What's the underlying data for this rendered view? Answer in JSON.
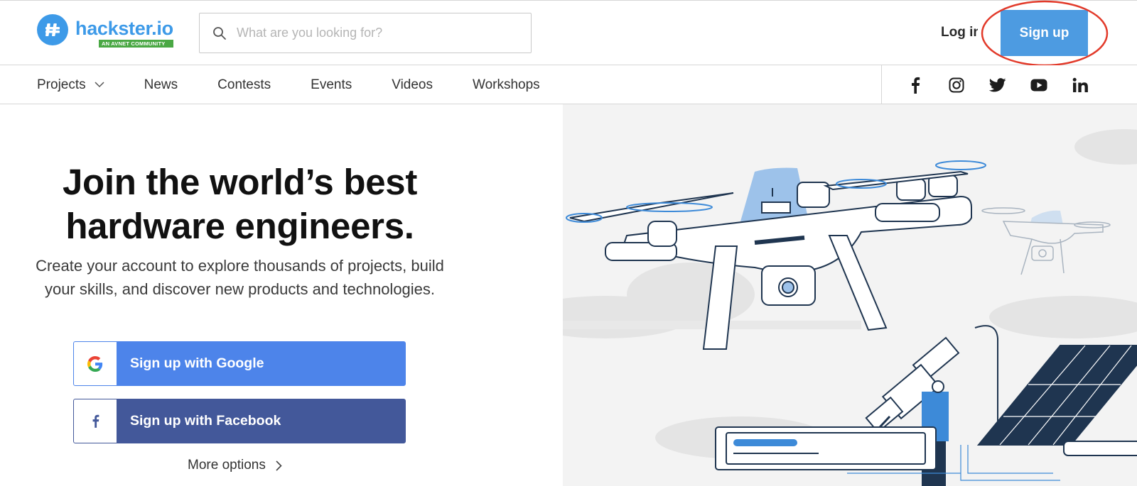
{
  "header": {
    "logo_text": "hackster.io",
    "logo_badge": "AN AVNET COMMUNITY",
    "search_placeholder": "What are you looking for?",
    "login_label": "Log in",
    "signup_label": "Sign up"
  },
  "nav": {
    "items": [
      {
        "label": "Projects",
        "has_dropdown": true
      },
      {
        "label": "News"
      },
      {
        "label": "Contests"
      },
      {
        "label": "Events"
      },
      {
        "label": "Videos"
      },
      {
        "label": "Workshops"
      }
    ],
    "socials": [
      "facebook-icon",
      "instagram-icon",
      "twitter-icon",
      "youtube-icon",
      "linkedin-icon"
    ]
  },
  "main": {
    "headline_line1": "Join the world’s best",
    "headline_line2": "hardware engineers.",
    "subtext_line1": "Create your account to explore thousands of projects, build",
    "subtext_line2": "your skills, and discover new products and technologies.",
    "google_label": "Sign up with Google",
    "facebook_label": "Sign up with Facebook",
    "more_options_label": "More options"
  },
  "colors": {
    "brand_blue": "#3d9ae8",
    "signup_blue": "#4d9be1",
    "google_blue": "#4d84ea",
    "facebook_blue": "#43589a",
    "annotation_red": "#e23a2a",
    "badge_green": "#4aa844"
  }
}
